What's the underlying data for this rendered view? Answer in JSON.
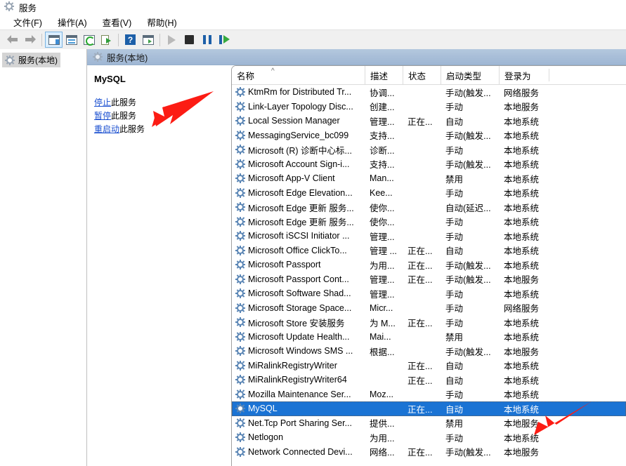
{
  "window": {
    "title": "服务",
    "icon": "services-gear-icon"
  },
  "menu": [
    {
      "label": "文件(F)",
      "accel": "F"
    },
    {
      "label": "操作(A)",
      "accel": "A"
    },
    {
      "label": "查看(V)",
      "accel": "V"
    },
    {
      "label": "帮助(H)",
      "accel": "H"
    }
  ],
  "toolbar": {
    "buttons": [
      {
        "name": "back-icon",
        "tip": "后退"
      },
      {
        "name": "forward-icon",
        "tip": "前进"
      },
      {
        "name": "show-hide-console-tree-icon",
        "tip": "显示/隐藏控制台树"
      },
      {
        "name": "properties-icon",
        "tip": "属性"
      },
      {
        "name": "refresh-icon",
        "tip": "刷新"
      },
      {
        "name": "export-list-icon",
        "tip": "导出列表"
      },
      {
        "name": "help-icon",
        "tip": "帮助"
      },
      {
        "name": "show-action-pane-icon",
        "tip": "显示操作窗格"
      },
      {
        "name": "start-service-icon",
        "tip": "启动服务"
      },
      {
        "name": "stop-service-icon",
        "tip": "停止服务"
      },
      {
        "name": "pause-service-icon",
        "tip": "暂停服务"
      },
      {
        "name": "restart-service-icon",
        "tip": "重启动服务"
      }
    ]
  },
  "tree": {
    "root_label": "服务(本地)"
  },
  "pane": {
    "header_label": "服务(本地)"
  },
  "details": {
    "service_name": "MySQL",
    "links": [
      {
        "action": "停止",
        "tail": "此服务"
      },
      {
        "action": "暂停",
        "tail": "此服务"
      },
      {
        "action": "重启动",
        "tail": "此服务"
      }
    ]
  },
  "list": {
    "columns": [
      {
        "key": "name",
        "label": "名称",
        "sorted": "asc",
        "sort_glyph": "^"
      },
      {
        "key": "desc",
        "label": "描述"
      },
      {
        "key": "state",
        "label": "状态"
      },
      {
        "key": "startup",
        "label": "启动类型"
      },
      {
        "key": "logon",
        "label": "登录为"
      }
    ],
    "rows": [
      {
        "name": "KtmRm for Distributed Tr...",
        "desc": "协调...",
        "state": "",
        "startup": "手动(触发...",
        "logon": "网络服务",
        "selected": false
      },
      {
        "name": "Link-Layer Topology Disc...",
        "desc": "创建...",
        "state": "",
        "startup": "手动",
        "logon": "本地服务",
        "selected": false
      },
      {
        "name": "Local Session Manager",
        "desc": "管理...",
        "state": "正在...",
        "startup": "自动",
        "logon": "本地系统",
        "selected": false
      },
      {
        "name": "MessagingService_bc099",
        "desc": "支持...",
        "state": "",
        "startup": "手动(触发...",
        "logon": "本地系统",
        "selected": false
      },
      {
        "name": "Microsoft (R) 诊断中心标...",
        "desc": "诊断...",
        "state": "",
        "startup": "手动",
        "logon": "本地系统",
        "selected": false
      },
      {
        "name": "Microsoft Account Sign-i...",
        "desc": "支持...",
        "state": "",
        "startup": "手动(触发...",
        "logon": "本地系统",
        "selected": false
      },
      {
        "name": "Microsoft App-V Client",
        "desc": "Man...",
        "state": "",
        "startup": "禁用",
        "logon": "本地系统",
        "selected": false
      },
      {
        "name": "Microsoft Edge Elevation...",
        "desc": "Kee...",
        "state": "",
        "startup": "手动",
        "logon": "本地系统",
        "selected": false
      },
      {
        "name": "Microsoft Edge 更新 服务...",
        "desc": "使你...",
        "state": "",
        "startup": "自动(延迟...",
        "logon": "本地系统",
        "selected": false
      },
      {
        "name": "Microsoft Edge 更新 服务...",
        "desc": "使你...",
        "state": "",
        "startup": "手动",
        "logon": "本地系统",
        "selected": false
      },
      {
        "name": "Microsoft iSCSI Initiator ...",
        "desc": "管理...",
        "state": "",
        "startup": "手动",
        "logon": "本地系统",
        "selected": false
      },
      {
        "name": "Microsoft Office ClickTo...",
        "desc": "管理 ...",
        "state": "正在...",
        "startup": "自动",
        "logon": "本地系统",
        "selected": false
      },
      {
        "name": "Microsoft Passport",
        "desc": "为用...",
        "state": "正在...",
        "startup": "手动(触发...",
        "logon": "本地系统",
        "selected": false
      },
      {
        "name": "Microsoft Passport Cont...",
        "desc": "管理...",
        "state": "正在...",
        "startup": "手动(触发...",
        "logon": "本地服务",
        "selected": false
      },
      {
        "name": "Microsoft Software Shad...",
        "desc": "管理...",
        "state": "",
        "startup": "手动",
        "logon": "本地系统",
        "selected": false
      },
      {
        "name": "Microsoft Storage Space...",
        "desc": "Micr...",
        "state": "",
        "startup": "手动",
        "logon": "网络服务",
        "selected": false
      },
      {
        "name": "Microsoft Store 安装服务",
        "desc": "为 M...",
        "state": "正在...",
        "startup": "手动",
        "logon": "本地系统",
        "selected": false
      },
      {
        "name": "Microsoft Update Health...",
        "desc": "Mai...",
        "state": "",
        "startup": "禁用",
        "logon": "本地系统",
        "selected": false
      },
      {
        "name": "Microsoft Windows SMS ...",
        "desc": "根据...",
        "state": "",
        "startup": "手动(触发...",
        "logon": "本地服务",
        "selected": false
      },
      {
        "name": "MiRalinkRegistryWriter",
        "desc": "",
        "state": "正在...",
        "startup": "自动",
        "logon": "本地系统",
        "selected": false
      },
      {
        "name": "MiRalinkRegistryWriter64",
        "desc": "",
        "state": "正在...",
        "startup": "自动",
        "logon": "本地系统",
        "selected": false
      },
      {
        "name": "Mozilla Maintenance Ser...",
        "desc": "Moz...",
        "state": "",
        "startup": "手动",
        "logon": "本地系统",
        "selected": false
      },
      {
        "name": "MySQL",
        "desc": "",
        "state": "正在...",
        "startup": "自动",
        "logon": "本地系统",
        "selected": true
      },
      {
        "name": "Net.Tcp Port Sharing Ser...",
        "desc": "提供...",
        "state": "",
        "startup": "禁用",
        "logon": "本地服务",
        "selected": false
      },
      {
        "name": "Netlogon",
        "desc": "为用...",
        "state": "",
        "startup": "手动",
        "logon": "本地系统",
        "selected": false
      },
      {
        "name": "Network Connected Devi...",
        "desc": "网络...",
        "state": "正在...",
        "startup": "手动(触发...",
        "logon": "本地服务",
        "selected": false
      }
    ]
  },
  "annotations": {
    "color": "#fc1c14",
    "arrows": [
      {
        "name": "arrow-pointing-to-service-links"
      },
      {
        "name": "arrow-pointing-to-mysql-row"
      }
    ]
  }
}
